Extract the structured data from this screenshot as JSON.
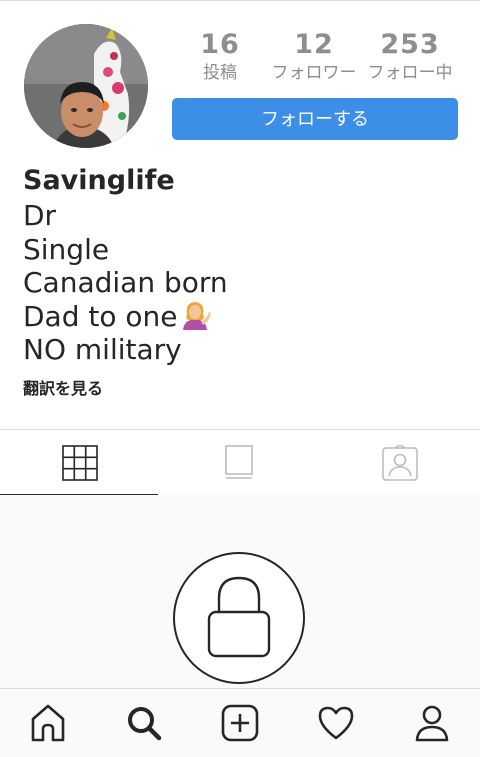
{
  "profile": {
    "username": "Savinglife",
    "bio_lines": [
      "Dr",
      "Single",
      "Canadian born",
      "Dad to one",
      "NO military"
    ],
    "bio_emoji": "person-tipping-hand-emoji",
    "translate_label": "翻訳を見る"
  },
  "stats": {
    "posts": {
      "value": "16",
      "label": "投稿"
    },
    "followers": {
      "value": "12",
      "label": "フォロワー"
    },
    "following": {
      "value": "253",
      "label": "フォロー中"
    }
  },
  "follow_button": {
    "label": "フォローする",
    "color": "#3d8ee6"
  },
  "tabs": [
    {
      "icon": "grid-icon",
      "active": true
    },
    {
      "icon": "list-icon",
      "active": false
    },
    {
      "icon": "tagged-icon",
      "active": false
    }
  ],
  "private_account": {
    "icon": "lock-icon"
  },
  "bottom_nav": [
    {
      "icon": "home-icon"
    },
    {
      "icon": "search-icon",
      "active": true
    },
    {
      "icon": "add-post-icon"
    },
    {
      "icon": "heart-icon"
    },
    {
      "icon": "profile-icon"
    }
  ]
}
